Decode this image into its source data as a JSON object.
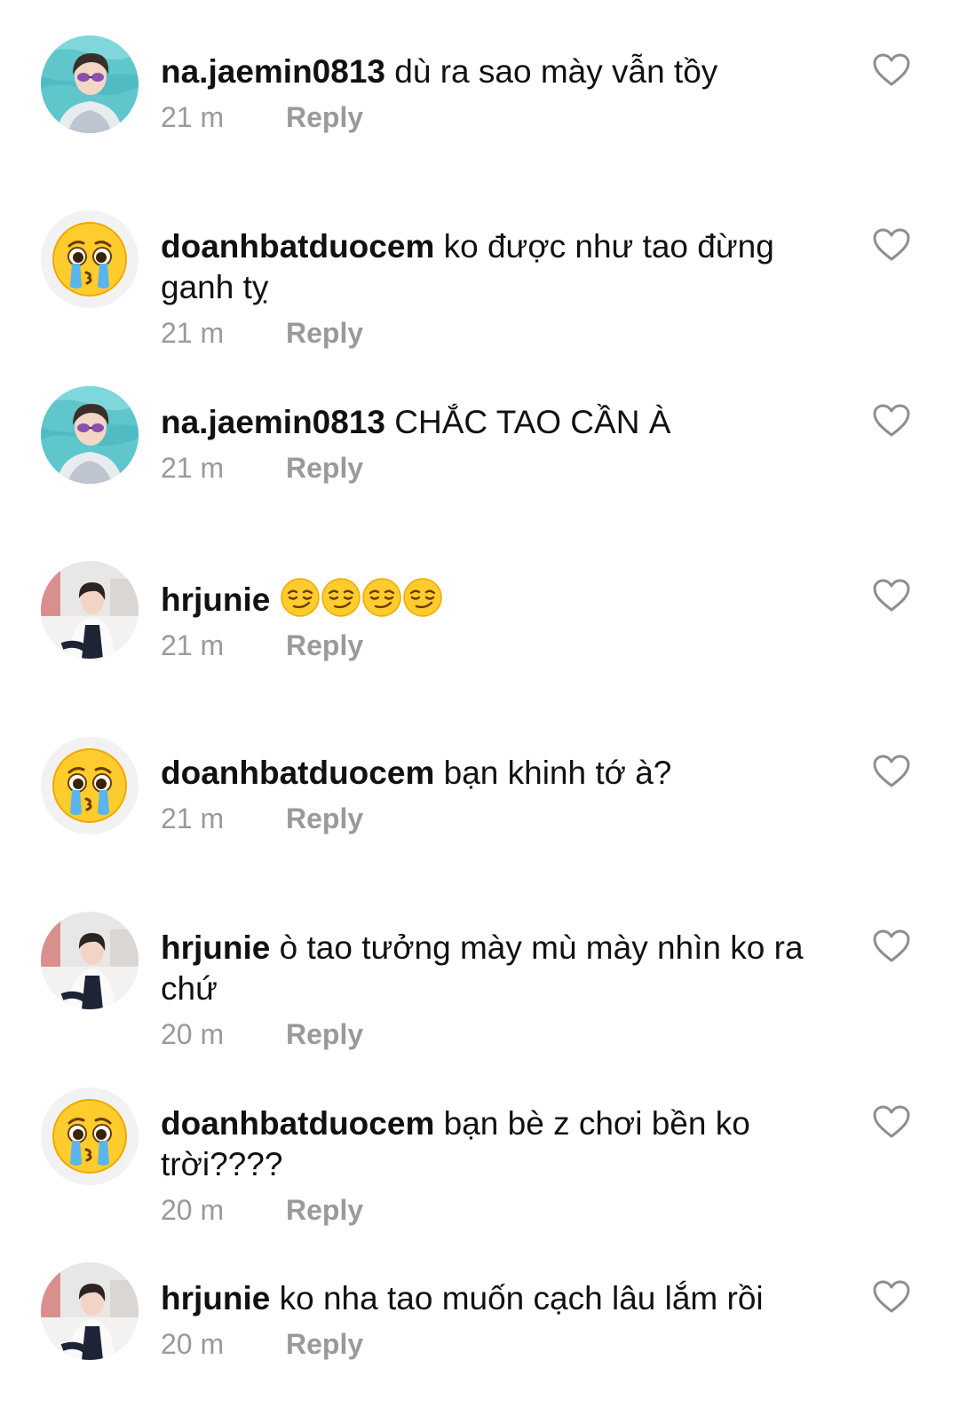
{
  "comments": [
    {
      "username": "na.jaemin0813",
      "text": "dù ra sao mày vẫn tồy",
      "time": "21 m",
      "reply_label": "Reply",
      "avatar": "photo-boy-pool-sunglasses"
    },
    {
      "username": "doanhbatduocem",
      "text": "ko được như tao đừng ganh tỵ",
      "time": "21 m",
      "reply_label": "Reply",
      "avatar": "emoji-pleading-crying"
    },
    {
      "username": "na.jaemin0813",
      "text": "CHẮC TAO CẦN À",
      "time": "21 m",
      "reply_label": "Reply",
      "avatar": "photo-boy-pool-sunglasses"
    },
    {
      "username": "hrjunie",
      "text": "😏😏😏😏",
      "time": "21 m",
      "reply_label": "Reply",
      "avatar": "photo-boy-sitting-white-room"
    },
    {
      "username": "doanhbatduocem",
      "text": "bạn khinh tớ à?",
      "time": "21 m",
      "reply_label": "Reply",
      "avatar": "emoji-pleading-crying"
    },
    {
      "username": "hrjunie",
      "text": "ò tao tưởng mày mù mày nhìn ko ra chứ",
      "time": "20 m",
      "reply_label": "Reply",
      "avatar": "photo-boy-sitting-white-room"
    },
    {
      "username": "doanhbatduocem",
      "text": "bạn bè z chơi bền ko trời????",
      "time": "20 m",
      "reply_label": "Reply",
      "avatar": "emoji-pleading-crying"
    },
    {
      "username": "hrjunie",
      "text": "ko nha tao muốn cạch lâu lắm rồi",
      "time": "20 m",
      "reply_label": "Reply",
      "avatar": "photo-boy-sitting-white-room"
    }
  ],
  "icons": {
    "like": "heart-outline-icon"
  },
  "colors": {
    "meta_text": "#9a9a9a",
    "body_text": "#111111",
    "background": "#ffffff"
  }
}
